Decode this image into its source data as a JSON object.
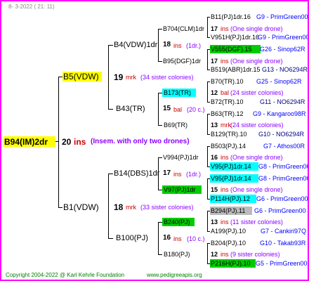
{
  "header": {
    "date": "8-  3-2022 ( 21: 11)"
  },
  "footer": {
    "copyright": "Copyright 2004-2022 @ Karl Kehrle Foundation",
    "site": "www.pedigreeapis.org"
  },
  "colors": {
    "frame": "#ff00ff",
    "root_highlight": "#ffff00",
    "cyan_highlight": "#00ffff",
    "green_highlight": "#00cc00",
    "grey_highlight": "#bbbbbb"
  },
  "root": {
    "name": "B94(IM)2dr",
    "ins_count": "20",
    "ins_label": "ins",
    "note": "(Insem. with only two drones)"
  },
  "gen1": [
    {
      "name": "B5(VDW)",
      "count": "19",
      "unit": "mrk",
      "note": "(34 sister colonies)"
    },
    {
      "name": "B1(VDW)",
      "count": "18",
      "unit": "mrk",
      "note": "(33 sister colonies)"
    }
  ],
  "gen2": [
    {
      "name": "B4(VDW)1dr",
      "count": "18",
      "unit": "ins",
      "note": "(1dr.)"
    },
    {
      "name": "B43(TR)",
      "count": "15",
      "unit": "bal",
      "note": "(20 c.)"
    },
    {
      "name": "B14(DBS)1dr",
      "count": "17",
      "unit": "ins",
      "note": "(1dr.)"
    },
    {
      "name": "B100(PJ)",
      "count": "16",
      "unit": "ins",
      "note": "(10 c.)"
    }
  ],
  "gen3": [
    {
      "name": "B704(CLM)1dr",
      "count": "17",
      "unit": "ins",
      "note": "(One single drone)"
    },
    {
      "name": "B95(DGF)1dr",
      "count": "17",
      "unit": "ins",
      "note": "(One single drone)"
    },
    {
      "name": "B173(TR)",
      "count": "12",
      "unit": "bal",
      "note": "(24 sister colonies)"
    },
    {
      "name": "B69(TR)",
      "count": "13",
      "unit": "mrk",
      "note": "(24 sister colonies)"
    },
    {
      "name": "V994(PJ)1dr",
      "count": "16",
      "unit": "ins",
      "note": "(One single drone)"
    },
    {
      "name": "V97(PJ)1dr",
      "count": "15",
      "unit": "ins",
      "note": "(One single drone)"
    },
    {
      "name": "B240(PJ)",
      "count": "13",
      "unit": "ins",
      "note": "(11 sister colonies)"
    },
    {
      "name": "B180(PJ)",
      "count": "12",
      "unit": "ins",
      "note": "(9 sister colonies)"
    }
  ],
  "gen4": [
    {
      "name": "B11(PJ)1dr.16",
      "code": "G9 - PrimGreen00"
    },
    {
      "name": "V951H(PJ)1dr.16",
      "code": "G9 - PrimGreen00"
    },
    {
      "name": "V555(DGF).15",
      "code": "G26 - Sinop62R"
    },
    {
      "name": "B519(ABR)1dr.15",
      "code": "G13 - NO6294R"
    },
    {
      "name": "B70(TR).10",
      "code": "G25 - Sinop62R"
    },
    {
      "name": "B72(TR).10",
      "code": "G11 - NO6294R"
    },
    {
      "name": "B63(TR).12",
      "code": "G9 - Kangaroo98R"
    },
    {
      "name": "B129(TR).10",
      "code": "G10 - NO6294R"
    },
    {
      "name": "B503(PJ).14",
      "code": "G7 - Athos00R"
    },
    {
      "name": "V95(PJ)1dr.14",
      "code": "G8 - PrimGreen00"
    },
    {
      "name": "V95(PJ)1dr.14",
      "code": "G8 - PrimGreen00"
    },
    {
      "name": "P114H(PJ).12",
      "code": "G6 - PrimGreen00"
    },
    {
      "name": "B294(PJ).11",
      "code": "G6 - PrimGreen00"
    },
    {
      "name": "A199(PJ).10",
      "code": "G7 - Cankiri97Q"
    },
    {
      "name": "B204(PJ).10",
      "code": "G10 - Takab93R"
    },
    {
      "name": "P216H(PJ).10",
      "code": "G5 - PrimGreen00"
    }
  ]
}
